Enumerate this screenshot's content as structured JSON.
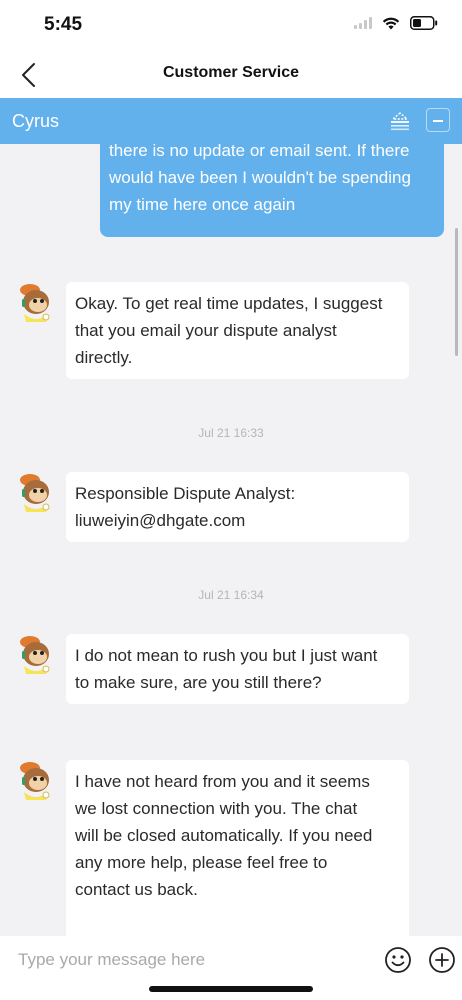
{
  "status_bar": {
    "time": "5:45"
  },
  "nav": {
    "title": "Customer Service",
    "back_icon": "chevron-left-icon"
  },
  "agent_bar": {
    "name": "Cyrus",
    "color": "#62b1ec"
  },
  "messages": {
    "user_1": {
      "lines": [
        "there is no update or email sent. If there",
        "would have been I wouldn't be spending",
        "my time here once again"
      ]
    },
    "agent_1": {
      "lines": [
        "Okay. To get real time updates, I suggest",
        "that you email your dispute analyst",
        "directly."
      ]
    },
    "timestamp_1": "Jul 21 16:33",
    "agent_2": {
      "lines": [
        "Responsible Dispute Analyst:",
        "liuweiyin@dhgate.com"
      ]
    },
    "timestamp_2": "Jul 21 16:34",
    "agent_3": {
      "lines": [
        "I do not mean to rush you but I just want",
        "to make sure, are you still there?"
      ]
    },
    "agent_4": {
      "lines": [
        "I have not heard from you and it seems",
        "we lost connection with you. The chat",
        "will be closed automatically. If you need",
        "any more help, please feel free to",
        "contact us back."
      ]
    }
  },
  "composer": {
    "placeholder": "Type your message here",
    "emoji_icon": "smiley-icon",
    "plus_icon": "plus-circle-icon"
  }
}
